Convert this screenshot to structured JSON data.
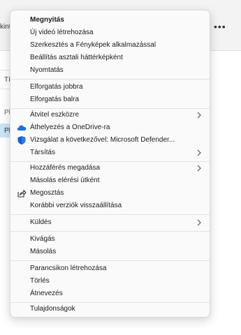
{
  "background": {
    "toolbar_fragment": "kint",
    "more_icon": "more-icon",
    "column_header_fragment": "Tí",
    "row1_fragment": "Pl",
    "row2_fragment": "Pl"
  },
  "menu": {
    "items": [
      {
        "label": "Megnyitás",
        "bold": true
      },
      {
        "label": "Új videó létrehozása"
      },
      {
        "label": "Szerkesztés a Fényképek alkalmazással"
      },
      {
        "label": "Beállítás asztali háttérképként"
      },
      {
        "label": "Nyomtatás"
      },
      {
        "label": "Elforgatás jobbra"
      },
      {
        "label": "Elforgatás balra"
      },
      {
        "label": "Átvitel eszközre",
        "submenu": true
      },
      {
        "label": "Áthelyezés a OneDrive-ra",
        "icon": "onedrive-icon"
      },
      {
        "label": "Vizsgálat a következővel: Microsoft Defender...",
        "icon": "defender-shield-icon"
      },
      {
        "label": "Társítás",
        "submenu": true
      },
      {
        "label": "Hozzáférés megadása",
        "submenu": true
      },
      {
        "label": "Másolás elérési útként"
      },
      {
        "label": "Megosztás",
        "icon": "share-icon"
      },
      {
        "label": "Korábbi verziók visszaállítása"
      },
      {
        "label": "Küldés",
        "submenu": true
      },
      {
        "label": "Kivágás"
      },
      {
        "label": "Másolás"
      },
      {
        "label": "Parancsikon létrehozása"
      },
      {
        "label": "Törlés"
      },
      {
        "label": "Átnevezés"
      },
      {
        "label": "Tulajdonságok"
      }
    ],
    "colors": {
      "onedrive": "#1a73d9",
      "defender": "#1560c7",
      "separator": "#e3e3e3"
    }
  }
}
